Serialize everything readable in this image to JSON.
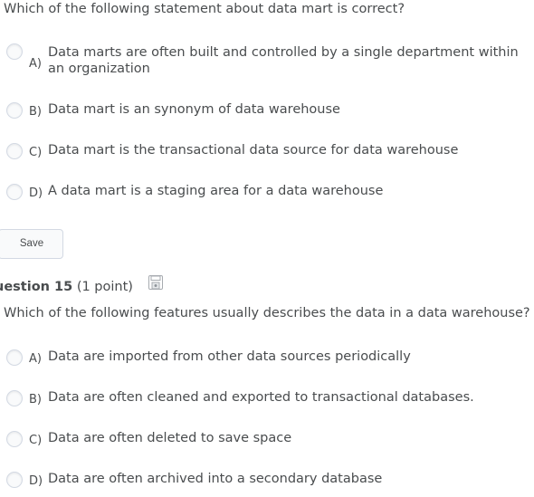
{
  "question14": {
    "prompt": "Which of the following statement about data mart is correct?",
    "options": [
      {
        "letter": "A)",
        "text": "Data marts are often built and controlled by a single department within an organization"
      },
      {
        "letter": "B)",
        "text": "Data mart is an synonym of data warehouse"
      },
      {
        "letter": "C)",
        "text": "Data mart is the transactional data source for data warehouse"
      },
      {
        "letter": "D)",
        "text": "A data mart is a staging area for a data warehouse"
      }
    ]
  },
  "save_button": {
    "label": "Save"
  },
  "question15": {
    "title": "uestion 15",
    "points": "(1 point)",
    "save_icon": "floppy-disk-icon",
    "prompt": "Which of the following features usually describes the data in a data warehouse?",
    "options": [
      {
        "letter": "A)",
        "text": "Data are imported from other data sources periodically"
      },
      {
        "letter": "B)",
        "text": "Data are often cleaned and exported to transactional databases."
      },
      {
        "letter": "C)",
        "text": "Data are often deleted to save space"
      },
      {
        "letter": "D)",
        "text": "Data are often archived into a secondary database"
      }
    ]
  },
  "colors": {
    "text": "#494c4e",
    "radio_border": "#d3d9e3",
    "button_bg": "#f9fafb"
  }
}
